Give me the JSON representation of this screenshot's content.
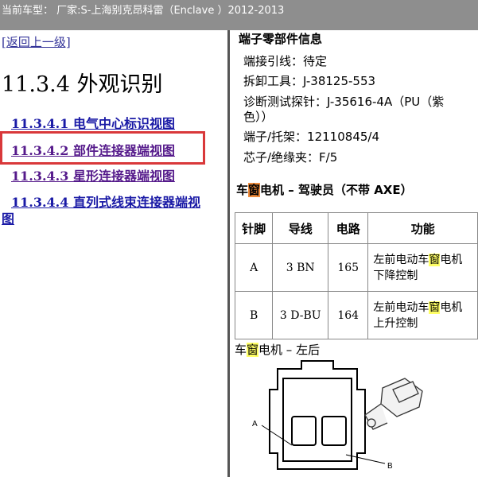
{
  "header": {
    "title": "当前车型：  厂家:S-上海别克昂科雷（Enclave ）2012-2013"
  },
  "nav": {
    "back_label": "[返回上一级]",
    "section_title": "11.3.4 外观识别",
    "items": [
      {
        "label": "11.3.4.1 电气中心标识视图"
      },
      {
        "label": "11.3.4.2 部件连接器端视图"
      },
      {
        "label": "11.3.4.3 星形连接器端视图"
      },
      {
        "label": "11.3.4.4 直列式线束连接器端视"
      },
      {
        "label": "图"
      }
    ]
  },
  "content": {
    "part_info_title": "端子零部件信息",
    "lines": [
      "端接引线：待定",
      "拆卸工具：J-38125-553",
      "诊断测试探针：J-35616-4A（PU（紫",
      "色））",
      "端子/托架：12110845/4",
      "芯子/绝缘夹：F/5"
    ],
    "connector_heading": {
      "pre": "车",
      "hl": "窗",
      "post": "电机 – 驾驶员（不带 AXE）"
    },
    "table": {
      "headers": [
        "针脚",
        "导线",
        "电路",
        "功能"
      ],
      "rows": [
        {
          "pin": "A",
          "wire": "3 BN",
          "circuit": "165",
          "func_pre": "左前电动车",
          "func_hl": "窗",
          "func_post": "电机",
          "func_line2": "下降控制"
        },
        {
          "pin": "B",
          "wire": "3 D-BU",
          "circuit": "164",
          "func_pre": "左前电动车",
          "func_hl": "窗",
          "func_post": "电机",
          "func_line2": "上升控制"
        }
      ]
    },
    "caption": {
      "pre": "车",
      "hl": "窗",
      "post": "电机 – 左后"
    },
    "diagram": {
      "label_a": "A",
      "label_b": "B"
    }
  }
}
